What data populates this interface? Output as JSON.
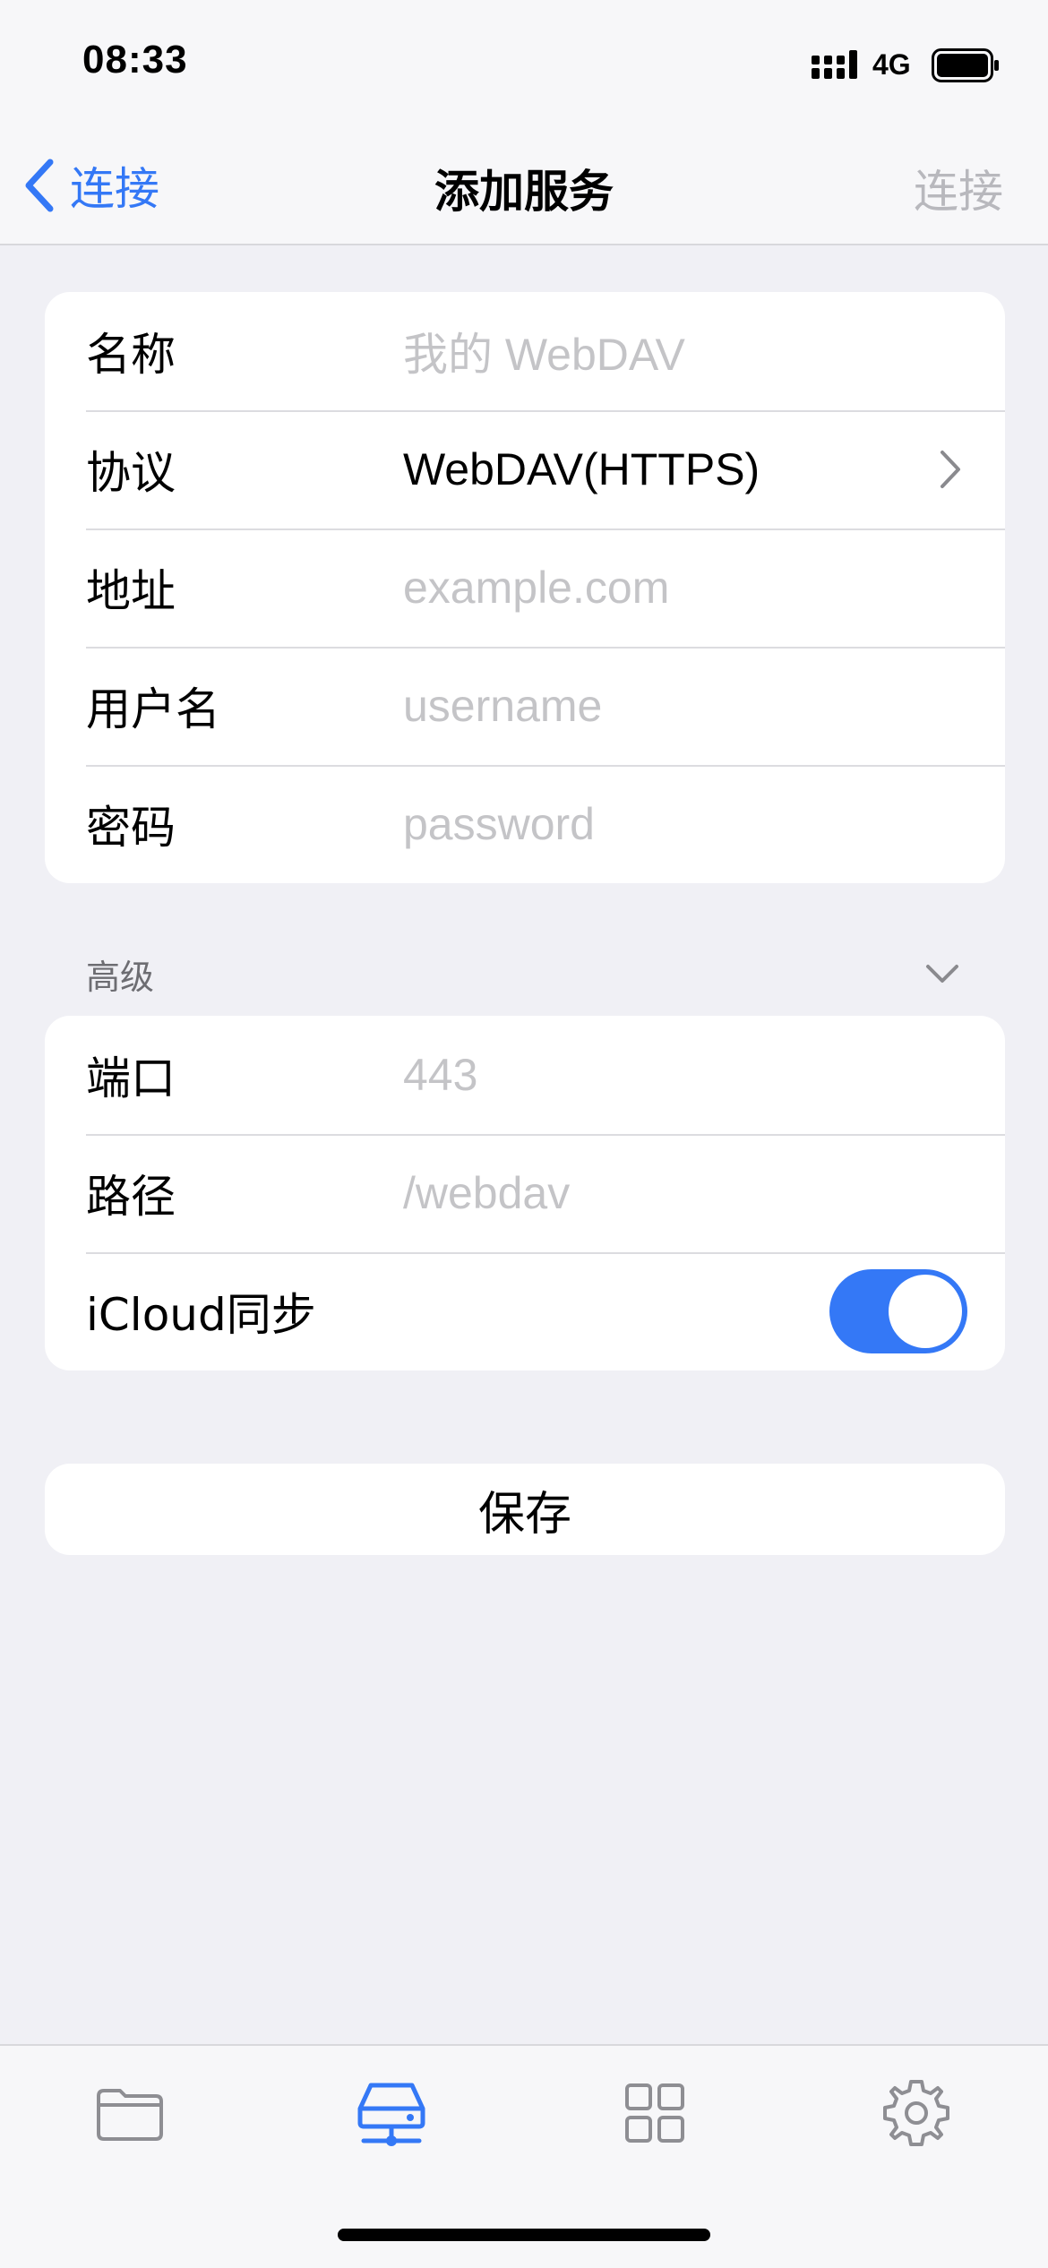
{
  "status_bar": {
    "time": "08:33",
    "network": "4G"
  },
  "nav": {
    "back_label": "连接",
    "title": "添加服务",
    "action_label": "连接"
  },
  "form": {
    "name_label": "名称",
    "name_placeholder": "我的 WebDAV",
    "protocol_label": "协议",
    "protocol_value": "WebDAV(HTTPS)",
    "address_label": "地址",
    "address_placeholder": "example.com",
    "username_label": "用户名",
    "username_placeholder": "username",
    "password_label": "密码",
    "password_placeholder": "password"
  },
  "advanced": {
    "header": "高级",
    "port_label": "端口",
    "port_placeholder": "443",
    "path_label": "路径",
    "path_placeholder": "/webdav",
    "icloud_label": "iCloud同步",
    "icloud_enabled": true
  },
  "save_label": "保存",
  "tabs": [
    {
      "icon": "folder-icon"
    },
    {
      "icon": "server-icon",
      "active": true
    },
    {
      "icon": "grid-icon"
    },
    {
      "icon": "gear-icon"
    }
  ],
  "colors": {
    "accent": "#3478f6",
    "placeholder": "#c4c4c7",
    "background": "#f0f0f5"
  }
}
